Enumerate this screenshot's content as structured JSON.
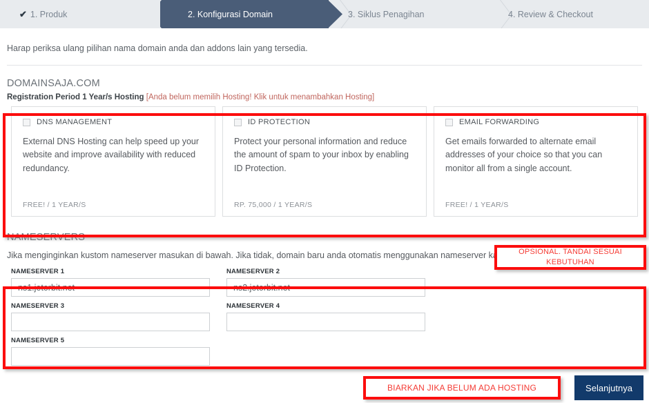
{
  "steps": [
    {
      "label": "1. Produk",
      "state": "done",
      "check": "✔",
      "icon": "check-icon"
    },
    {
      "label": "2. Konfigurasi Domain",
      "state": "active"
    },
    {
      "label": "3. Siklus Penagihan",
      "state": "todo"
    },
    {
      "label": "4. Review & Checkout",
      "state": "todo"
    }
  ],
  "intro": "Harap periksa ulang pilihan nama domain anda dan addons lain yang tersedia.",
  "domain": {
    "name": "DOMAINSAJA.COM",
    "registration": "Registration Period 1 Year/s Hosting",
    "warning": "[Anda belum memilih Hosting! Klik untuk menambahkan Hosting]"
  },
  "addons": [
    {
      "title": "DNS MANAGEMENT",
      "description": "External DNS Hosting can help speed up your website and improve availability with reduced redundancy.",
      "price": "FREE! / 1 YEAR/S",
      "checked": false
    },
    {
      "title": "ID PROTECTION",
      "description": "Protect your personal information and reduce the amount of spam to your inbox by enabling ID Protection.",
      "price": "RP. 75,000 / 1 YEAR/S",
      "checked": false
    },
    {
      "title": "EMAIL FORWARDING",
      "description": "Get emails forwarded to alternate email addresses of your choice so that you can monitor all from a single account.",
      "price": "FREE! / 1 YEAR/S",
      "checked": false
    }
  ],
  "nameservers": {
    "title": "NAMESERVERS",
    "subtitle": "Jika menginginkan kustom nameserver masukan di bawah. Jika tidak, domain baru anda otomatis menggunakan nameserver kami. Klik Selanjutnya.",
    "fields": [
      {
        "label": "NAMESERVER 1",
        "value": "ns1.jetorbit.net",
        "placeholder": ""
      },
      {
        "label": "NAMESERVER 2",
        "value": "ns2.jetorbit.net",
        "placeholder": ""
      },
      {
        "label": "NAMESERVER 3",
        "value": "",
        "placeholder": ""
      },
      {
        "label": "NAMESERVER 4",
        "value": "",
        "placeholder": ""
      },
      {
        "label": "NAMESERVER 5",
        "value": "",
        "placeholder": ""
      }
    ]
  },
  "annotations": {
    "optional": "OPSIONAL. TANDAI SESUAI KEBUTUHAN",
    "hosting": "BIARKAN JIKA BELUM ADA HOSTING",
    "color": "#fc0d0d",
    "text_color": "#f43b34"
  },
  "footer": {
    "next_label": "Selanjutnya"
  },
  "colors": {
    "active_step": "#4a5d78",
    "step_bar": "#e8ebee",
    "next_button": "#123a6b",
    "warning_text": "#c0655d"
  }
}
